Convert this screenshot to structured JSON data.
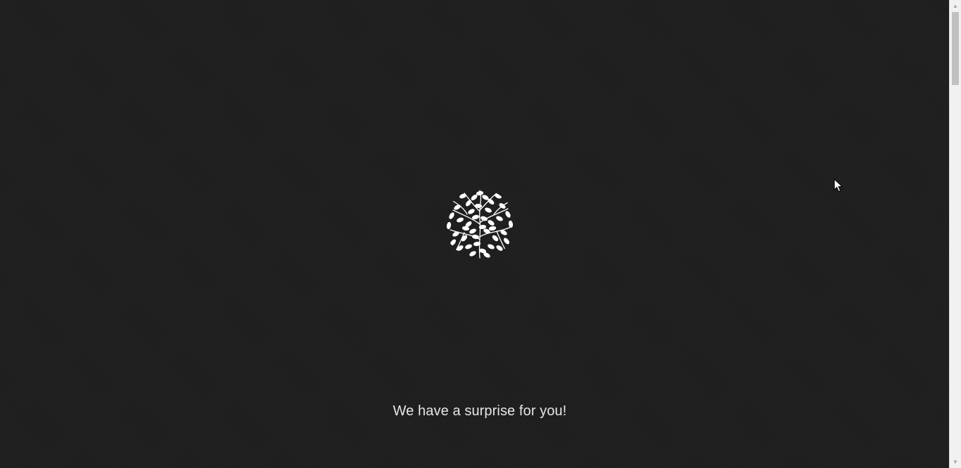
{
  "page": {
    "tagline": "We have a surprise for you!",
    "background_color": "#1f1f1f",
    "text_color": "#e6e6e6"
  },
  "logo": {
    "icon": "leaf-tree-circle-icon",
    "fill_color": "#ffffff"
  },
  "scrollbar": {
    "up_icon": "scroll-up-arrow-icon",
    "down_icon": "scroll-down-arrow-icon"
  },
  "cursor": {
    "icon": "mouse-pointer-icon"
  }
}
